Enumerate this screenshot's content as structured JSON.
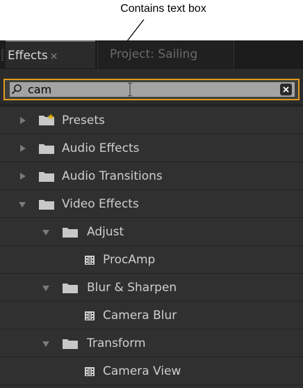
{
  "annotation": {
    "callout_text": "Contains text box"
  },
  "tabs": [
    {
      "label": "Effects",
      "close": "×",
      "active": true
    },
    {
      "label": "Project: Sailing",
      "active": false
    }
  ],
  "search": {
    "value": "cam",
    "clear": "×"
  },
  "tree": [
    {
      "label": "Presets",
      "expanded": false,
      "type": "preset-folder"
    },
    {
      "label": "Audio Effects",
      "expanded": false,
      "type": "folder"
    },
    {
      "label": "Audio Transitions",
      "expanded": false,
      "type": "folder"
    },
    {
      "label": "Video Effects",
      "expanded": true,
      "type": "folder"
    },
    {
      "label": "Adjust",
      "expanded": true,
      "type": "folder"
    },
    {
      "label": "ProcAmp",
      "type": "effect"
    },
    {
      "label": "Blur & Sharpen",
      "expanded": true,
      "type": "folder"
    },
    {
      "label": "Camera Blur",
      "type": "effect"
    },
    {
      "label": "Transform",
      "expanded": true,
      "type": "folder"
    },
    {
      "label": "Camera View",
      "type": "effect"
    }
  ],
  "colors": {
    "accent": "#e39a1f",
    "panel_bg": "#303030",
    "folder": "#c8c8c8",
    "preset_star": "#e0b000"
  }
}
